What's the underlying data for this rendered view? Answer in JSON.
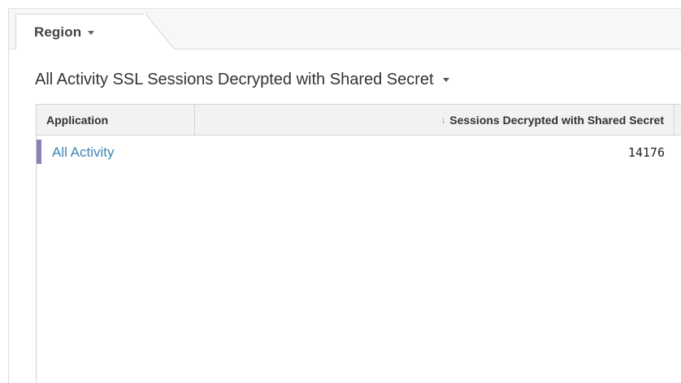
{
  "tab": {
    "label": "Region"
  },
  "panel": {
    "title": "All Activity SSL Sessions Decrypted with Shared Secret"
  },
  "table": {
    "columns": [
      {
        "label": "Application"
      },
      {
        "label": "Sessions Decrypted with Shared Secret",
        "sort": "descending"
      }
    ],
    "rows": [
      {
        "application": "All Activity",
        "sessions": "14176"
      }
    ]
  },
  "colors": {
    "link": "#3d86b8",
    "row_marker": "#8a82b8",
    "header_bg": "#f2f2f2"
  },
  "icons": {
    "tab_dropdown": "chevron-down-icon",
    "title_dropdown": "chevron-down-icon",
    "sort_indicator": "sort-down-arrow-icon"
  }
}
